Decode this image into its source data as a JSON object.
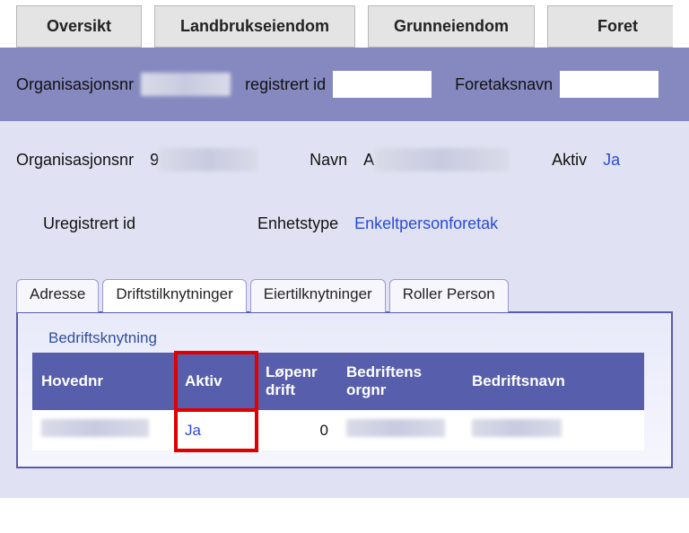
{
  "toptabs": {
    "t0": "Oversikt",
    "t1": "Landbrukseiendom",
    "t2": "Grunneiendom",
    "t3": "Foret"
  },
  "filter": {
    "orgnr_label": "Organisasjonsnr",
    "uregid_label": "registrert id",
    "foretaksnavn_label": "Foretaksnavn"
  },
  "details": {
    "orgnr_label": "Organisasjonsnr",
    "orgnr_value": "9",
    "navn_label": "Navn",
    "navn_value": "A",
    "aktiv_label": "Aktiv",
    "aktiv_value": "Ja",
    "uregid_label": "Uregistrert id",
    "enhetstype_label": "Enhetstype",
    "enhetstype_value": "Enkeltpersonforetak"
  },
  "subtabs": {
    "adresse": "Adresse",
    "drift": "Driftstilknytninger",
    "eier": "Eiertilknytninger",
    "roller": "Roller Person"
  },
  "table": {
    "section_link": "Bedriftsknytning",
    "headers": {
      "hovednr": "Hovednr",
      "aktiv": "Aktiv",
      "lopenr": "Løpenr drift",
      "orgnr": "Bedriftens orgnr",
      "navn": "Bedriftsnavn"
    },
    "rows": [
      {
        "hovednr": "",
        "aktiv": "Ja",
        "lopenr": "0",
        "orgnr": "",
        "navn": ""
      }
    ]
  }
}
